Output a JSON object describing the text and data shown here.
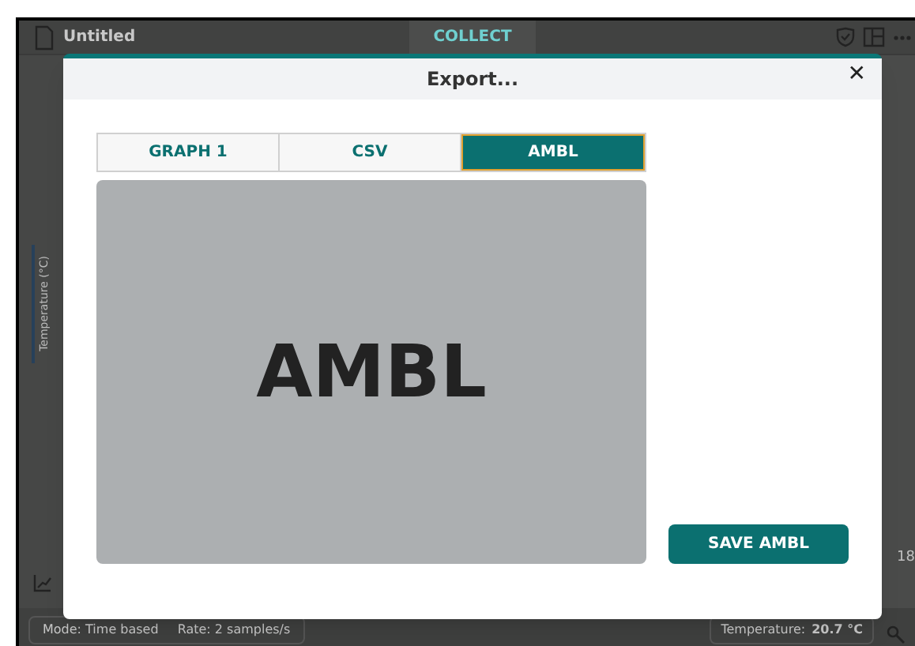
{
  "app": {
    "title": "Untitled",
    "tab": "COLLECT",
    "axis_label": "Temperature (°C)",
    "tick": "18",
    "status": {
      "mode": "Mode: Time based",
      "rate": "Rate: 2 samples/s",
      "reading_label": "Temperature:",
      "reading_value": "20.7 °C"
    }
  },
  "dialog": {
    "title": "Export...",
    "close": "✕",
    "tabs": [
      {
        "label": "GRAPH 1",
        "selected": false
      },
      {
        "label": "CSV",
        "selected": false
      },
      {
        "label": "AMBL",
        "selected": true
      }
    ],
    "preview": "AMBL",
    "save_button": "SAVE AMBL"
  }
}
